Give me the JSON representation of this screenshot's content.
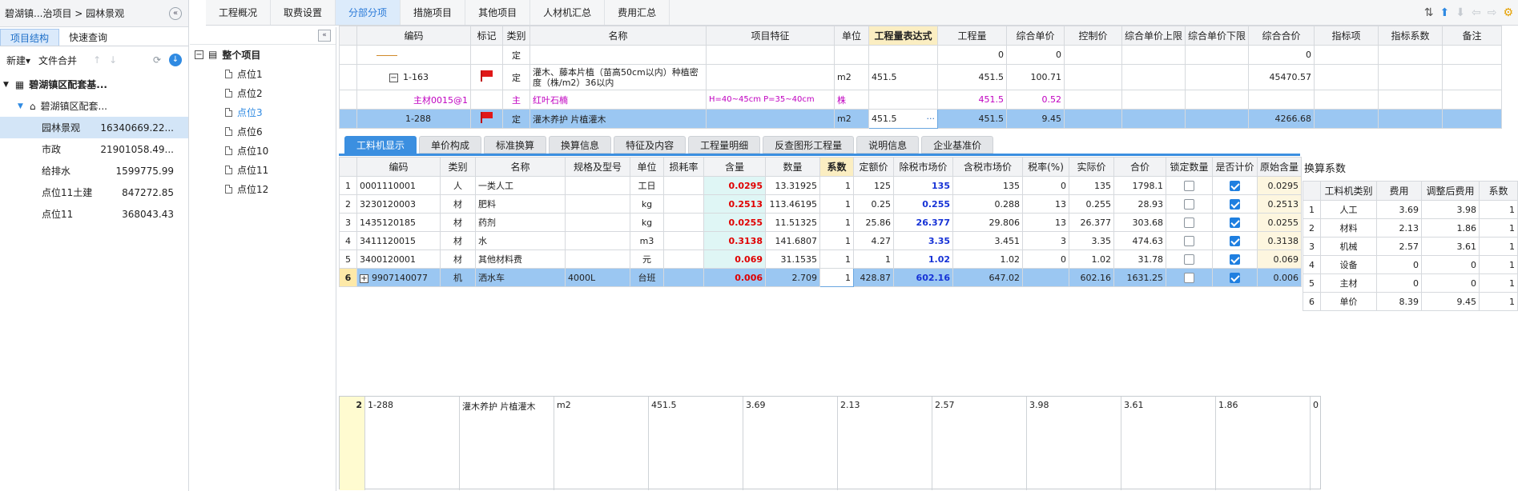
{
  "breadcrumb": "碧湖镇...治项目 > 园林景观",
  "left": {
    "tabs": [
      "项目结构",
      "快速查询"
    ],
    "tools": {
      "new": "新建",
      "merge": "文件合并"
    },
    "tree": [
      {
        "label": "碧湖镇区配套基..."
      },
      {
        "label": "碧湖镇区配套..."
      }
    ],
    "items": [
      {
        "name": "园林景观",
        "amount": "16340669.22..."
      },
      {
        "name": "市政",
        "amount": "21901058.49..."
      },
      {
        "name": "给排水",
        "amount": "1599775.99"
      },
      {
        "name": "点位11土建",
        "amount": "847272.85"
      },
      {
        "name": "点位11",
        "amount": "368043.43"
      }
    ]
  },
  "midtree": {
    "root": "整个项目",
    "items": [
      "点位1",
      "点位2",
      "点位3",
      "点位6",
      "点位10",
      "点位11",
      "点位12"
    ]
  },
  "toptabs": [
    "工程概况",
    "取费设置",
    "分部分项",
    "措施项目",
    "其他项目",
    "人材机汇总",
    "费用汇总"
  ],
  "upper": {
    "headers": [
      "编码",
      "标记",
      "类别",
      "名称",
      "项目特征",
      "单位",
      "工程量表达式",
      "工程量",
      "综合单价",
      "控制价",
      "综合单价上限",
      "综合单价下限",
      "综合合价",
      "指标项",
      "指标系数",
      "备注"
    ],
    "rows": [
      {
        "code": "",
        "type": "定",
        "name": "",
        "feature": "",
        "unit": "",
        "expr": "",
        "qty": "0",
        "price": "0",
        "total": "0"
      },
      {
        "code": "1-163",
        "type": "定",
        "name1": "灌木、藤本片植（苗高50cm以内）种植密",
        "name2": "度（株/m2）36以内",
        "feature": "",
        "unit": "m2",
        "expr": "451.5",
        "qty": "451.5",
        "price": "100.71",
        "total": "45470.57"
      },
      {
        "code": "主材0015@1",
        "type": "主",
        "name": "红叶石楠",
        "feature": "H=40~45cm P=35~40cm",
        "unit": "株",
        "expr": "",
        "qty": "451.5",
        "price": "0.52",
        "total": ""
      },
      {
        "code": "1-288",
        "type": "定",
        "name": "灌木养护 片植灌木",
        "feature": "",
        "unit": "m2",
        "expr": "451.5",
        "qty": "451.5",
        "price": "9.45",
        "total": "4266.68"
      }
    ]
  },
  "midtabs": [
    "工料机显示",
    "单价构成",
    "标准换算",
    "换算信息",
    "特征及内容",
    "工程量明细",
    "反查图形工程量",
    "说明信息",
    "企业基准价"
  ],
  "lower": {
    "headers": [
      "",
      "编码",
      "类别",
      "名称",
      "规格及型号",
      "单位",
      "损耗率",
      "含量",
      "数量",
      "系数",
      "定额价",
      "除税市场价",
      "含税市场价",
      "税率(%)",
      "实际价",
      "合价",
      "锁定数量",
      "是否计价",
      "原始含量"
    ],
    "rows": [
      {
        "no": "1",
        "code": "0001110001",
        "type": "人",
        "name": "一类人工",
        "spec": "",
        "unit": "工日",
        "loss": "",
        "content": "0.0295",
        "count": "13.31925",
        "coef": "1",
        "quota": "125",
        "exmarket": "135",
        "inmarket": "135",
        "tax": "0",
        "real": "135",
        "sum": "1798.1",
        "lock": false,
        "priced": true,
        "orig": "0.0295"
      },
      {
        "no": "2",
        "code": "3230120003",
        "type": "材",
        "name": "肥料",
        "spec": "",
        "unit": "kg",
        "loss": "",
        "content": "0.2513",
        "count": "113.46195",
        "coef": "1",
        "quota": "0.25",
        "exmarket": "0.255",
        "inmarket": "0.288",
        "tax": "13",
        "real": "0.255",
        "sum": "28.93",
        "lock": false,
        "priced": true,
        "orig": "0.2513"
      },
      {
        "no": "3",
        "code": "1435120185",
        "type": "材",
        "name": "药剂",
        "spec": "",
        "unit": "kg",
        "loss": "",
        "content": "0.0255",
        "count": "11.51325",
        "coef": "1",
        "quota": "25.86",
        "exmarket": "26.377",
        "inmarket": "29.806",
        "tax": "13",
        "real": "26.377",
        "sum": "303.68",
        "lock": false,
        "priced": true,
        "orig": "0.0255"
      },
      {
        "no": "4",
        "code": "3411120015",
        "type": "材",
        "name": "水",
        "spec": "",
        "unit": "m3",
        "loss": "",
        "content": "0.3138",
        "count": "141.6807",
        "coef": "1",
        "quota": "4.27",
        "exmarket": "3.35",
        "inmarket": "3.451",
        "tax": "3",
        "real": "3.35",
        "sum": "474.63",
        "lock": false,
        "priced": true,
        "orig": "0.3138"
      },
      {
        "no": "5",
        "code": "3400120001",
        "type": "材",
        "name": "其他材料费",
        "spec": "",
        "unit": "元",
        "loss": "",
        "content": "0.069",
        "count": "31.1535",
        "coef": "1",
        "quota": "1",
        "exmarket": "1.02",
        "inmarket": "1.02",
        "tax": "0",
        "real": "1.02",
        "sum": "31.78",
        "lock": false,
        "priced": true,
        "orig": "0.069"
      },
      {
        "no": "6",
        "code": "9907140077",
        "type": "机",
        "name": "洒水车",
        "spec": "4000L",
        "unit": "台班",
        "loss": "",
        "content": "0.006",
        "count": "2.709",
        "coef": "1",
        "quota": "428.87",
        "exmarket": "602.16",
        "inmarket": "647.02",
        "tax": "",
        "real": "602.16",
        "sum": "1631.25",
        "lock": false,
        "priced": true,
        "orig": "0.006"
      }
    ]
  },
  "calc": {
    "title": "换算系数",
    "headers": [
      "",
      "工料机类别",
      "费用",
      "调整后费用",
      "系数"
    ],
    "rows": [
      {
        "no": "1",
        "cat": "人工",
        "fee": "3.69",
        "adj": "3.98",
        "coef": "1"
      },
      {
        "no": "2",
        "cat": "材料",
        "fee": "2.13",
        "adj": "1.86",
        "coef": "1"
      },
      {
        "no": "3",
        "cat": "机械",
        "fee": "2.57",
        "adj": "3.61",
        "coef": "1"
      },
      {
        "no": "4",
        "cat": "设备",
        "fee": "0",
        "adj": "0",
        "coef": "1"
      },
      {
        "no": "5",
        "cat": "主材",
        "fee": "0",
        "adj": "0",
        "coef": "1"
      },
      {
        "no": "6",
        "cat": "单价",
        "fee": "8.39",
        "adj": "9.45",
        "coef": "1"
      }
    ]
  },
  "bottom": [
    "2",
    "1-288",
    "灌木养护 片植灌木",
    "m2",
    "451.5",
    "3.69",
    "2.13",
    "2.57",
    "3.98",
    "3.61",
    "1.86",
    "0"
  ]
}
